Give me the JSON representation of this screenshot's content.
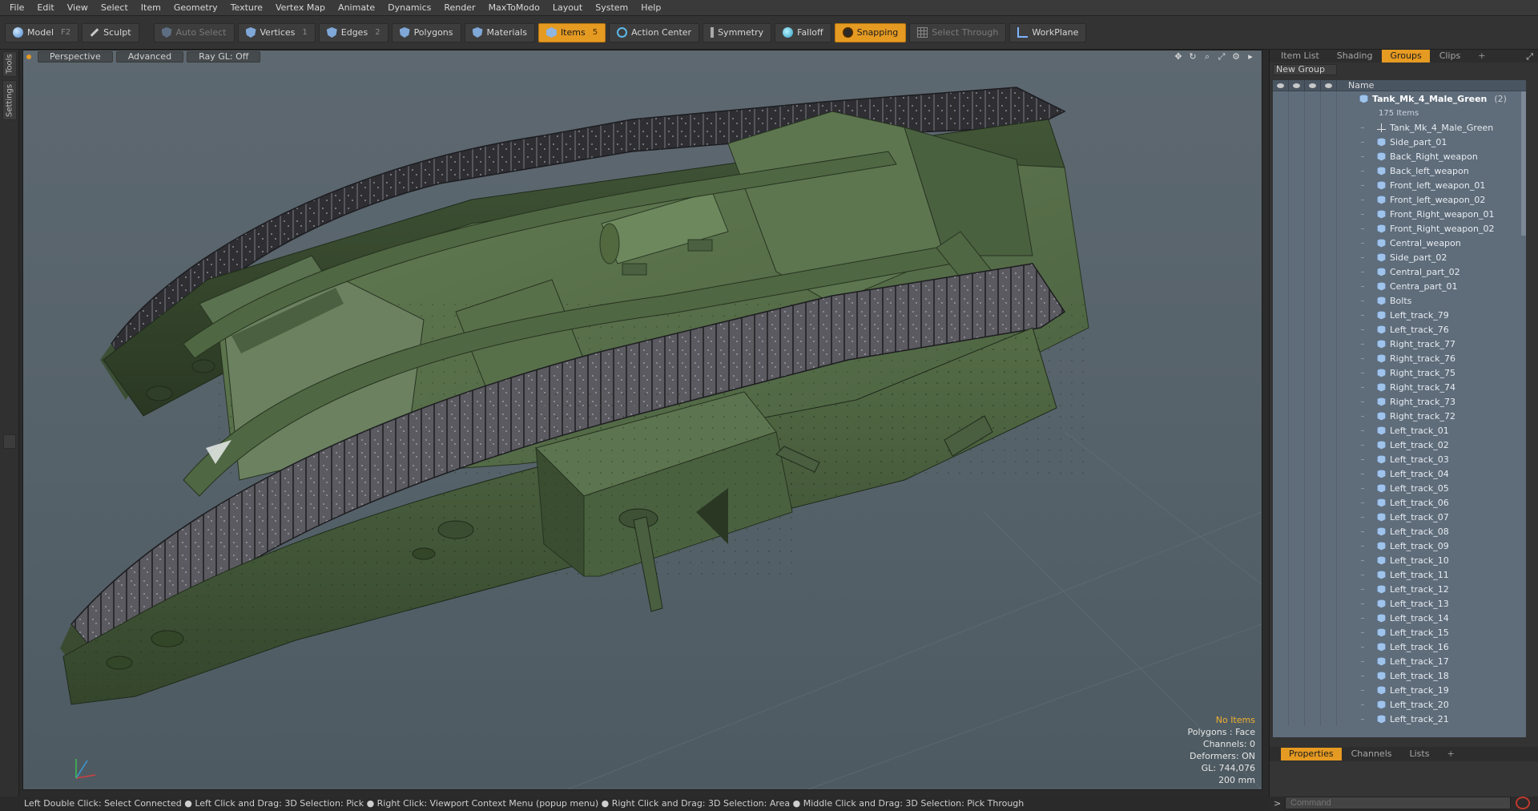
{
  "menu": [
    "File",
    "Edit",
    "View",
    "Select",
    "Item",
    "Geometry",
    "Texture",
    "Vertex Map",
    "Animate",
    "Dynamics",
    "Render",
    "MaxToModo",
    "Layout",
    "System",
    "Help"
  ],
  "toolbar": {
    "model": {
      "label": "Model",
      "key": "F2"
    },
    "sculpt": {
      "label": "Sculpt"
    },
    "auto_select": {
      "label": "Auto Select"
    },
    "vertices": {
      "label": "Vertices",
      "key": "1"
    },
    "edges": {
      "label": "Edges",
      "key": "2"
    },
    "polygons": {
      "label": "Polygons"
    },
    "materials": {
      "label": "Materials"
    },
    "items": {
      "label": "Items",
      "key": "5"
    },
    "action_center": {
      "label": "Action Center"
    },
    "symmetry": {
      "label": "Symmetry"
    },
    "falloff": {
      "label": "Falloff"
    },
    "snapping": {
      "label": "Snapping"
    },
    "select_through": {
      "label": "Select Through"
    },
    "workplane": {
      "label": "WorkPlane"
    }
  },
  "left_tabs": {
    "tools": "Tools",
    "settings": "Settings"
  },
  "viewport": {
    "view_mode": "Perspective",
    "shading": "Advanced",
    "raygl": "Ray GL: Off",
    "info": {
      "selection": "No Items",
      "polygons": "Polygons : Face",
      "channels": "Channels: 0",
      "deformers": "Deformers: ON",
      "gl": "GL: 744,076",
      "scale": "200 mm"
    }
  },
  "right_panel": {
    "tabs": [
      "Item List",
      "Shading",
      "Groups",
      "Clips"
    ],
    "active_tab": "Groups",
    "new_group": "New Group",
    "name_header": "Name",
    "group": {
      "name": "Tank_Mk_4_Male_Green",
      "count": "(2)",
      "items_count": "175 Items"
    },
    "items": [
      "Tank_Mk_4_Male_Green",
      "Side_part_01",
      "Back_Right_weapon",
      "Back_left_weapon",
      "Front_left_weapon_01",
      "Front_left_weapon_02",
      "Front_Right_weapon_01",
      "Front_Right_weapon_02",
      "Central_weapon",
      "Side_part_02",
      "Central_part_02",
      "Centra_part_01",
      "Bolts",
      "Left_track_79",
      "Left_track_76",
      "Right_track_77",
      "Right_track_76",
      "Right_track_75",
      "Right_track_74",
      "Right_track_73",
      "Right_track_72",
      "Left_track_01",
      "Left_track_02",
      "Left_track_03",
      "Left_track_04",
      "Left_track_05",
      "Left_track_06",
      "Left_track_07",
      "Left_track_08",
      "Left_track_09",
      "Left_track_10",
      "Left_track_11",
      "Left_track_12",
      "Left_track_13",
      "Left_track_14",
      "Left_track_15",
      "Left_track_16",
      "Left_track_17",
      "Left_track_18",
      "Left_track_19",
      "Left_track_20",
      "Left_track_21"
    ],
    "lower_tabs": [
      "Properties",
      "Channels",
      "Lists"
    ],
    "lower_active": "Properties"
  },
  "statusbar": "Left Double Click: Select Connected ● Left Click and Drag: 3D Selection: Pick ● Right Click: Viewport Context Menu (popup menu) ● Right Click and Drag: 3D Selection: Area ● Middle Click and Drag: 3D Selection: Pick Through",
  "command": {
    "placeholder": "Command"
  },
  "colors": {
    "accent": "#e59a22",
    "viewport_bg": "#5a666e",
    "tank_green": "#3f5335",
    "track_dark": "#2e2e32"
  }
}
